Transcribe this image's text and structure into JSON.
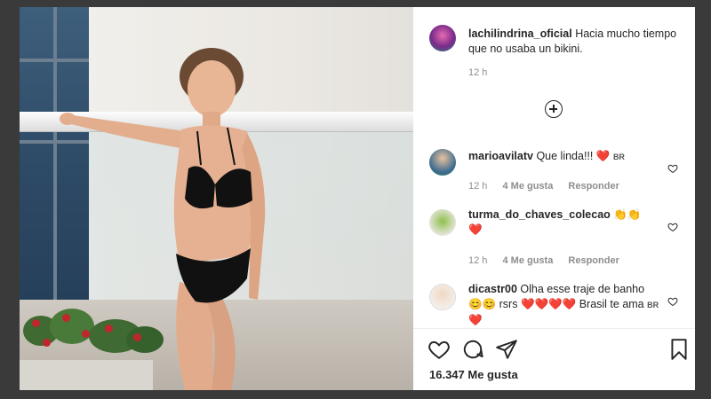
{
  "post": {
    "username": "lachilindrina_oficial",
    "caption": "Hacia mucho tiempo que no usaba un bikini.",
    "time": "12 h",
    "likes": "16.347 Me gusta"
  },
  "comments": [
    {
      "username": "marioavilatv",
      "text": "Que linda!!!",
      "emoji": "❤️",
      "flag": "BR",
      "time": "12 h",
      "likes": "4 Me gusta",
      "reply": "Responder"
    },
    {
      "username": "turma_do_chaves_colecao",
      "text": "",
      "emoji": "👏👏",
      "emoji2": "❤️",
      "time": "12 h",
      "likes": "4 Me gusta",
      "reply": "Responder"
    },
    {
      "username": "dicastr00",
      "text": "Olha esse traje de banho",
      "emoji": "😊😊",
      "text2": "rsrs",
      "emoji2": "❤️❤️❤️❤️",
      "text3": "Brasil te ama",
      "flag": "BR",
      "emoji3": "❤️"
    }
  ],
  "icons": {
    "like": "heart-icon",
    "comment": "comment-icon",
    "share": "paper-plane-icon",
    "save": "bookmark-icon",
    "more": "plus-circle-icon"
  }
}
